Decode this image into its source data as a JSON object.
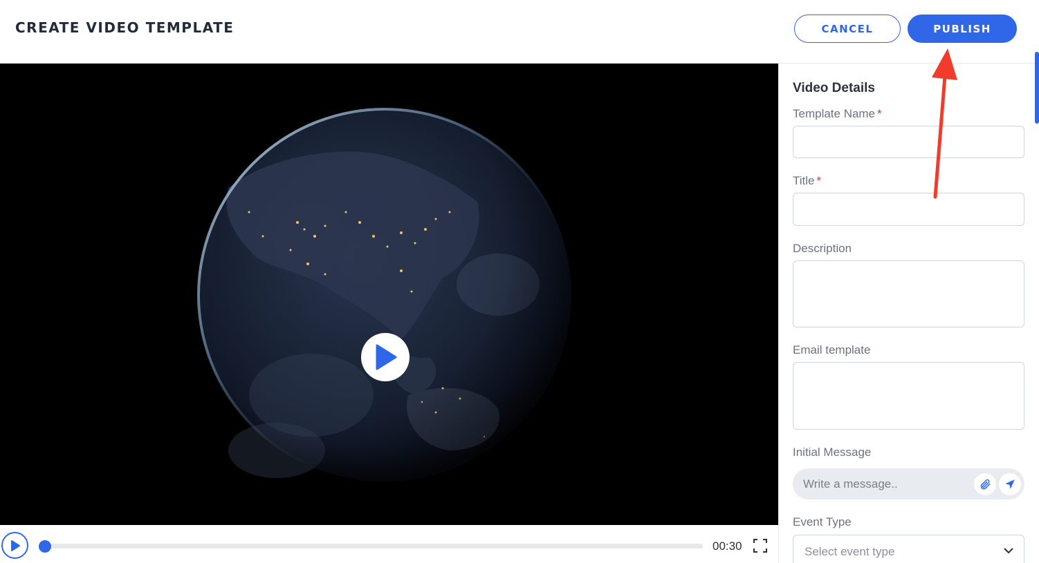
{
  "header": {
    "title": "CREATE VIDEO TEMPLATE",
    "cancel_label": "CANCEL",
    "publish_label": "PUBLISH"
  },
  "player": {
    "time": "00:30",
    "progress_fraction": 0.01
  },
  "sidebar": {
    "title": "Video Details",
    "template_name_label": "Template Name",
    "title_label": "Title",
    "description_label": "Description",
    "email_template_label": "Email template",
    "initial_message_label": "Initial Message",
    "message_placeholder": "Write a message..",
    "event_type_label": "Event Type",
    "event_type_placeholder": "Select event type",
    "required_mark": "*"
  },
  "colors": {
    "accent": "#2f67e8",
    "required": "#e0362c",
    "annotation_arrow": "#f23b2c"
  },
  "icons": [
    "play-icon",
    "fullscreen-icon",
    "paperclip-icon",
    "send-icon",
    "chevron-down-icon"
  ]
}
